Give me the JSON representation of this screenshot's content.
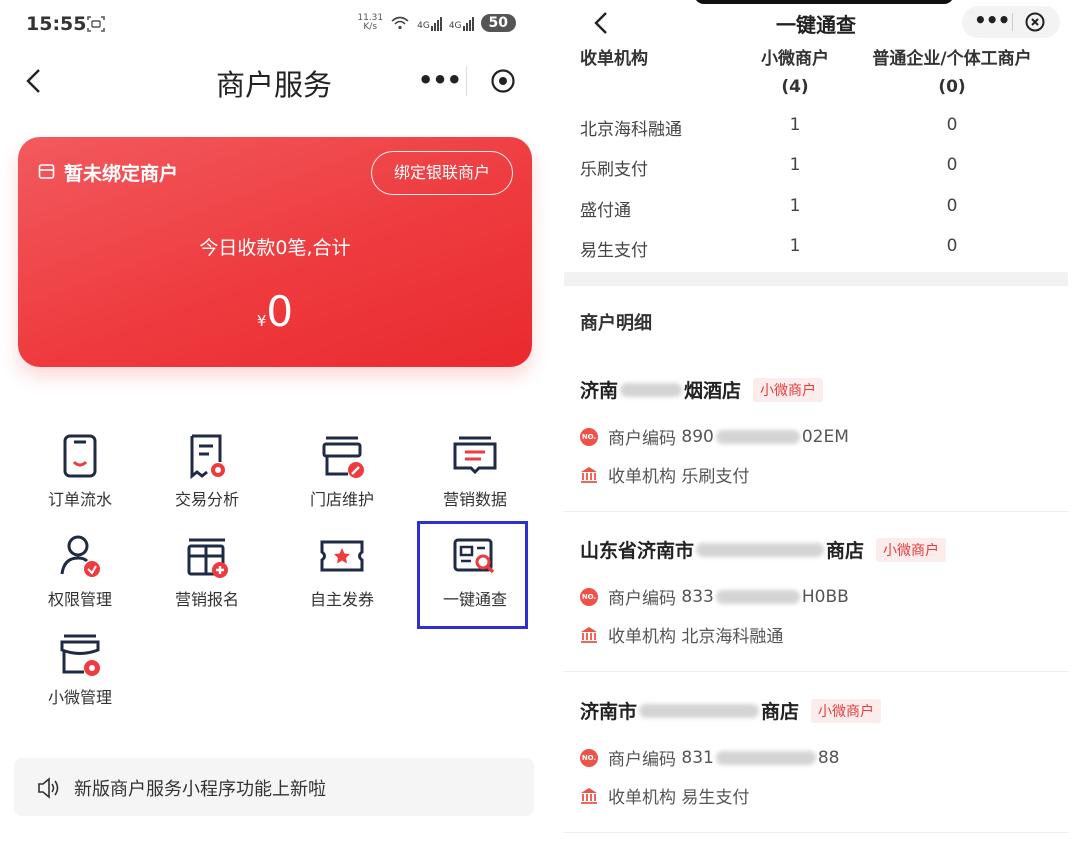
{
  "left": {
    "status": {
      "time": "15:55",
      "net_speed_value": "11.31",
      "net_speed_unit": "K/s",
      "battery": "50"
    },
    "nav": {
      "title": "商户服务"
    },
    "card": {
      "unbound_text": "暂未绑定商户",
      "bind_button": "绑定银联商户",
      "today_text": "今日收款0笔,合计",
      "currency": "¥",
      "amount": "0"
    },
    "grid": {
      "items": [
        {
          "label": "订单流水",
          "icon": "order-flow-icon"
        },
        {
          "label": "交易分析",
          "icon": "trade-analysis-icon"
        },
        {
          "label": "门店维护",
          "icon": "store-maintain-icon"
        },
        {
          "label": "营销数据",
          "icon": "marketing-data-icon"
        },
        {
          "label": "权限管理",
          "icon": "permission-icon"
        },
        {
          "label": "营销报名",
          "icon": "marketing-signup-icon"
        },
        {
          "label": "自主发券",
          "icon": "coupon-icon"
        },
        {
          "label": "一键通查",
          "icon": "one-click-query-icon"
        },
        {
          "label": "小微管理",
          "icon": "micro-manage-icon"
        }
      ]
    },
    "notice": {
      "text": "新版商户服务小程序功能上新啦"
    }
  },
  "right": {
    "nav": {
      "title": "一键通查"
    },
    "table": {
      "headers": {
        "acquirer": "收单机构",
        "micro": "小微商户",
        "micro_count": "(4)",
        "enterprise": "普通企业/个体工商户",
        "enterprise_count": "(0)"
      },
      "rows": [
        {
          "name": "北京海科融通",
          "micro": "1",
          "enterprise": "0"
        },
        {
          "name": "乐刷支付",
          "micro": "1",
          "enterprise": "0"
        },
        {
          "name": "盛付通",
          "micro": "1",
          "enterprise": "0"
        },
        {
          "name": "易生支付",
          "micro": "1",
          "enterprise": "0"
        }
      ]
    },
    "detail": {
      "title": "商户明细",
      "code_label": "商户编码",
      "acquirer_label": "收单机构",
      "merchants": [
        {
          "name_prefix": "济南",
          "name_suffix": "烟酒店",
          "tag": "小微商户",
          "code_prefix": "890",
          "code_suffix": "02EM",
          "acquirer": "乐刷支付"
        },
        {
          "name_prefix": "山东省济南市",
          "name_suffix": "商店",
          "tag": "小微商户",
          "code_prefix": "833",
          "code_suffix": "H0BB",
          "acquirer": "北京海科融通"
        },
        {
          "name_prefix": "济南市",
          "name_suffix": "商店",
          "tag": "小微商户",
          "code_prefix": "831",
          "code_suffix": "88",
          "acquirer": "易生支付"
        }
      ]
    }
  },
  "colors": {
    "accent_red": "#ee3b3f",
    "highlight_blue": "#2d2fd0",
    "icon_dark": "#1f2a44"
  }
}
